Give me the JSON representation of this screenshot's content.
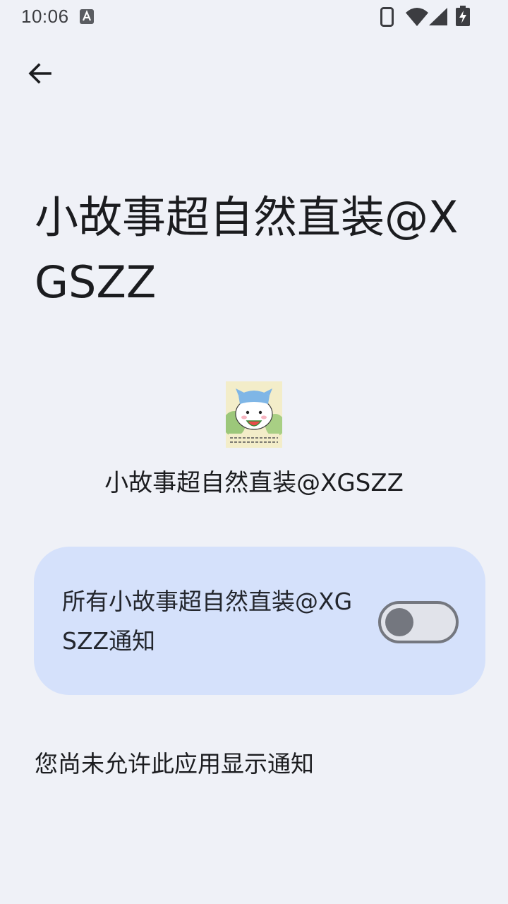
{
  "status_bar": {
    "time": "10:06",
    "icons": [
      "font-notification-icon",
      "phone-icon",
      "wifi-icon",
      "signal-icon",
      "battery-charging-icon"
    ]
  },
  "navigation": {
    "back_icon": "arrow-back-icon"
  },
  "page": {
    "title": "小故事超自然直装@XGSZZ",
    "app_name": "小故事超自然直装@XGSZZ",
    "app_icon": "app-icon-cartoon-cat"
  },
  "notification_toggle": {
    "label": "所有小故事超自然直装@XGSZZ通知",
    "enabled": false
  },
  "notice": "您尚未允许此应用显示通知",
  "colors": {
    "background": "#eff1f7",
    "card": "#d5e1fb",
    "switch_outline": "#74777f",
    "switch_track": "#e1e3ea"
  }
}
